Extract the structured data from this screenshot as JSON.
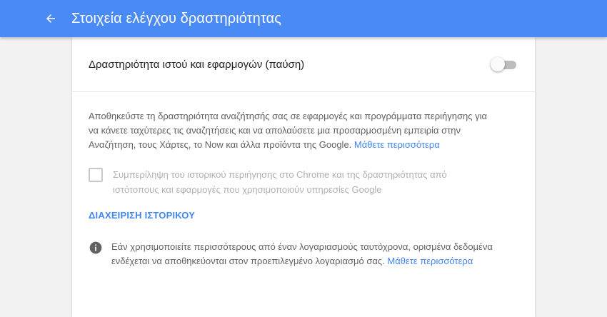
{
  "header": {
    "title": "Στοιχεία ελέγχου δραστηριότητας",
    "back_icon": "arrow-back-icon"
  },
  "web_activity": {
    "label": "Δραστηριότητα ιστού και εφαρμογών (παύση)",
    "enabled": false,
    "description": "Αποθηκεύστε τη δραστηριότητα αναζήτησής σας σε εφαρμογές και προγράμματα περιήγησης για να κάνετε ταχύτερες τις αναζητήσεις και να απολαύσετε μια προσαρμοσμένη εμπειρία στην Αναζήτηση, τους Χάρτες, το Now και άλλα προϊόντα της Google.",
    "learn_more": "Μάθετε περισσότερα",
    "include_chrome_label": "Συμπερίληψη του ιστορικού περιήγησης στο Chrome και της δραστηριότητας από ιστότοπους και εφαρμογές που χρησιμοποιούν υπηρεσίες Google",
    "include_chrome_checked": false,
    "manage_history": "ΔΙΑΧΕΙΡΙΣΗ ΙΣΤΟΡΙΚΟΥ"
  },
  "info": {
    "icon": "info-icon",
    "text": "Εάν χρησιμοποιείτε περισσότερους από έναν λογαριασμούς ταυτόχρονα, ορισμένα δεδομένα ενδέχεται να αποθηκεύονται στον προεπιλεγμένο λογαριασμό σας.",
    "learn_more": "Μάθετε περισσότερα"
  },
  "colors": {
    "header_bg": "#4a8af4",
    "link": "#4285f4",
    "background": "#f2f2f2"
  }
}
